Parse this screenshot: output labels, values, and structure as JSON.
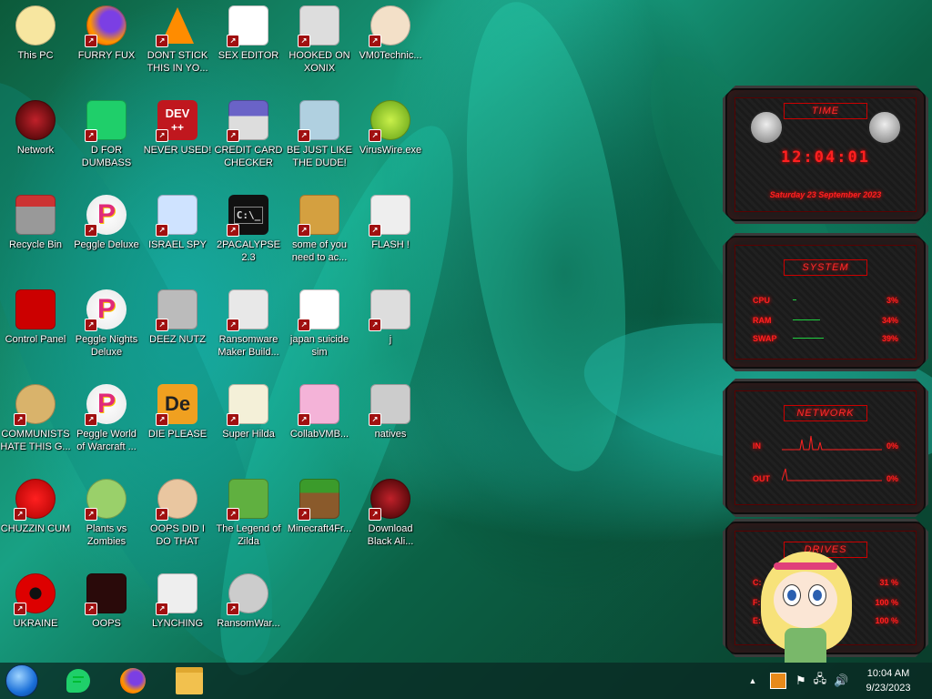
{
  "desktop": {
    "icons": [
      {
        "label": "This PC"
      },
      {
        "label": "FURRY FUX"
      },
      {
        "label": "DONT STICK THIS IN YO..."
      },
      {
        "label": "SEX EDITOR"
      },
      {
        "label": "HOOKED ON XONIX"
      },
      {
        "label": "VM0Technic..."
      },
      {
        "label": "Network"
      },
      {
        "label": "D FOR DUMBASS"
      },
      {
        "label": "NEVER USED!"
      },
      {
        "label": "CREDIT CARD CHECKER"
      },
      {
        "label": "BE JUST LIKE THE DUDE!"
      },
      {
        "label": "VirusWire.exe"
      },
      {
        "label": "Recycle Bin"
      },
      {
        "label": "Peggle Deluxe"
      },
      {
        "label": "ISRAEL SPY"
      },
      {
        "label": "2PACALYPSE 2.3"
      },
      {
        "label": "some of you need to ac..."
      },
      {
        "label": "FLASH !"
      },
      {
        "label": "Control Panel"
      },
      {
        "label": "Peggle Nights Deluxe"
      },
      {
        "label": "DEEZ NUTZ"
      },
      {
        "label": "Ransomware Maker Build..."
      },
      {
        "label": "japan suicide sim"
      },
      {
        "label": "j"
      },
      {
        "label": "COMMUNISTS HATE THIS G..."
      },
      {
        "label": "Peggle World of Warcraft ..."
      },
      {
        "label": "DIE PLEASE"
      },
      {
        "label": "Super Hilda"
      },
      {
        "label": "CollabVMB..."
      },
      {
        "label": "natives"
      },
      {
        "label": "CHUZZIN CUM"
      },
      {
        "label": "Plants vs Zombies"
      },
      {
        "label": "OOPS DID I DO THAT"
      },
      {
        "label": "The Legend of Zilda"
      },
      {
        "label": "Minecraft4Fr..."
      },
      {
        "label": "Download Black Ali..."
      },
      {
        "label": "UKRAINE"
      },
      {
        "label": "OOPS"
      },
      {
        "label": "LYNCHING"
      },
      {
        "label": "RansomWar..."
      }
    ],
    "icon_text": {
      "dev": "DEV",
      "dev_plus": "++",
      "de": "De",
      "p": "P",
      "cmd": "C:\\_"
    }
  },
  "gadgets": {
    "time": {
      "title": "TIME",
      "clock": "12:04:01",
      "date": "Saturday 23 September 2023"
    },
    "system": {
      "title": "SYSTEM",
      "rows": [
        {
          "label": "CPU",
          "value": "3%"
        },
        {
          "label": "RAM",
          "value": "34%"
        },
        {
          "label": "SWAP",
          "value": "39%"
        }
      ]
    },
    "network": {
      "title": "NETWORK",
      "rows": [
        {
          "label": "IN",
          "value": "0%"
        },
        {
          "label": "OUT",
          "value": "0%"
        }
      ]
    },
    "drives": {
      "title": "DRIVES",
      "rows": [
        {
          "label": "C:",
          "value": "31 %"
        },
        {
          "label": "F:",
          "value": "100 %"
        },
        {
          "label": "E:",
          "value": "100 %"
        }
      ]
    }
  },
  "taskbar": {
    "clock_time": "10:04 AM",
    "clock_date": "9/23/2023"
  },
  "colors": {
    "accent_red": "#ff2020",
    "gadget_bg": "#1b1b1b",
    "taskbar_bg": "#0a2823"
  }
}
